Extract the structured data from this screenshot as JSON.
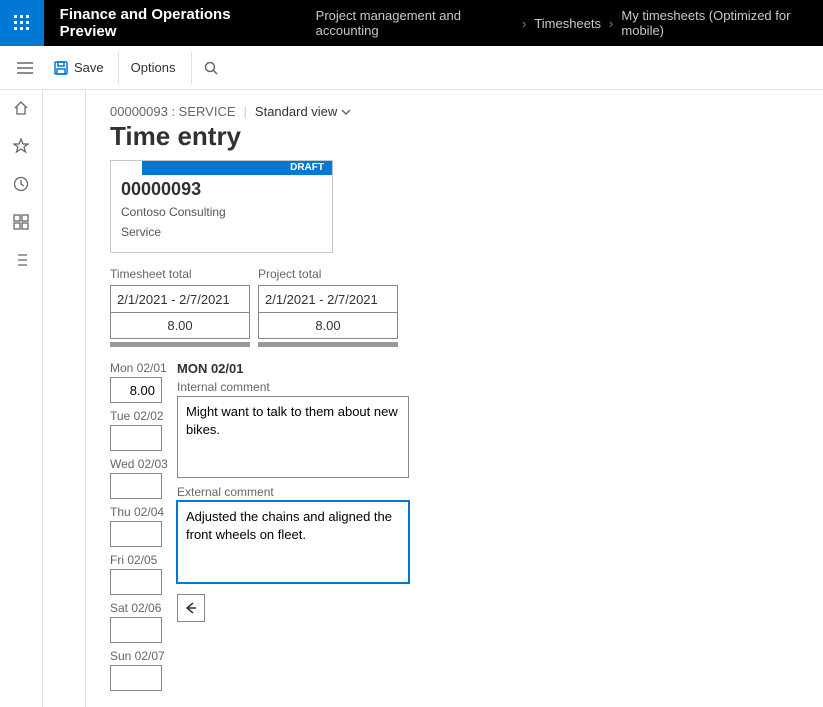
{
  "header": {
    "app_title": "Finance and Operations Preview",
    "breadcrumb": {
      "a": "Project management and accounting",
      "b": "Timesheets",
      "c": "My timesheets (Optimized for mobile)"
    }
  },
  "actionbar": {
    "save_label": "Save",
    "options_label": "Options"
  },
  "context": {
    "id_service": "00000093 : SERVICE",
    "view_label": "Standard view"
  },
  "page_title": "Time entry",
  "card": {
    "status": "DRAFT",
    "number": "00000093",
    "customer": "Contoso Consulting",
    "project": "Service"
  },
  "totals": {
    "timesheet_label": "Timesheet total",
    "timesheet_range": "2/1/2021 - 2/7/2021",
    "timesheet_value": "8.00",
    "project_label": "Project total",
    "project_range": "2/1/2021 - 2/7/2021",
    "project_value": "8.00"
  },
  "days": {
    "mon": {
      "label": "Mon 02/01",
      "value": "8.00"
    },
    "tue": {
      "label": "Tue 02/02",
      "value": ""
    },
    "wed": {
      "label": "Wed 02/03",
      "value": ""
    },
    "thu": {
      "label": "Thu 02/04",
      "value": ""
    },
    "fri": {
      "label": "Fri 02/05",
      "value": ""
    },
    "sat": {
      "label": "Sat 02/06",
      "value": ""
    },
    "sun": {
      "label": "Sun 02/07",
      "value": ""
    }
  },
  "detail": {
    "selected_day": "MON 02/01",
    "internal_label": "Internal comment",
    "internal_value": "Might want to talk to them about new bikes.",
    "external_label": "External comment",
    "external_value": "Adjusted the chains and aligned the front wheels on fleet."
  }
}
